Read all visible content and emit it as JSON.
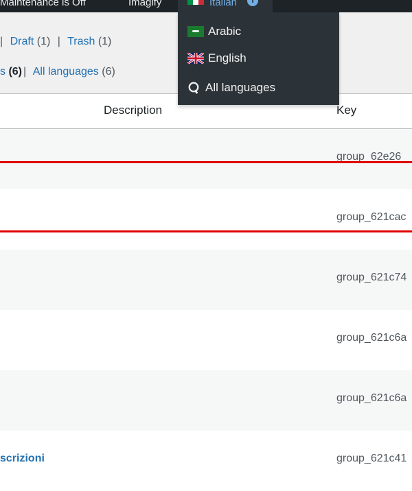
{
  "adminbar": {
    "maintenance": "Maintenance is Off",
    "imagify": "Imagify",
    "current_language": "Italian",
    "info_glyph": "i"
  },
  "language_menu": {
    "items": [
      {
        "label": "Arabic",
        "icon": "flag-saudi-arabia-icon"
      },
      {
        "label": "English",
        "icon": "flag-uk-icon"
      },
      {
        "label": "All languages",
        "icon": "globe-icon"
      }
    ]
  },
  "filters_row1": {
    "draft_label": "Draft",
    "draft_count": "(1)",
    "trash_label": "Trash",
    "trash_count": "(1)"
  },
  "filters_row2": {
    "partial_label": "s",
    "partial_count": "(6)",
    "all_label": "All languages",
    "all_count": "(6)"
  },
  "table": {
    "columns": {
      "description": "Description",
      "key": "Key"
    },
    "rows": [
      {
        "key": "group_62e26",
        "title": ""
      },
      {
        "key": "group_621cac",
        "title": ""
      },
      {
        "key": "group_621c74",
        "title": ""
      },
      {
        "key": "group_621c6a",
        "title": ""
      },
      {
        "key": "group_621c6a",
        "title": ""
      },
      {
        "key": "group_621c41",
        "title": "scrizioni"
      }
    ]
  },
  "colors": {
    "admin_bar": "#1d2327",
    "link": "#2271b1",
    "highlight": "#e00000"
  }
}
